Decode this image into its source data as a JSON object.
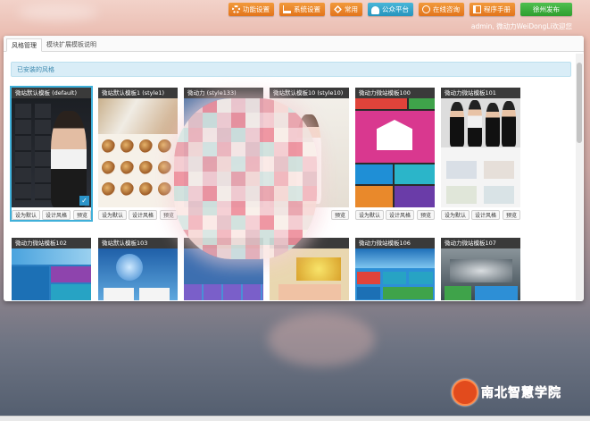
{
  "nav": {
    "buttons": [
      {
        "label": "功能设置",
        "icon": "gear-icon",
        "color": "#ee8a2e"
      },
      {
        "label": "系统设置",
        "icon": "cart-icon",
        "color": "#ee8a2e"
      },
      {
        "label": "常用",
        "icon": "tool-icon",
        "color": "#ee8a2e"
      },
      {
        "label": "公众平台",
        "icon": "cloud-icon",
        "color": "#3aa8d0"
      },
      {
        "label": "在线咨询",
        "icon": "chat-icon",
        "color": "#ee8a2e"
      },
      {
        "label": "程序手册",
        "icon": "book-icon",
        "color": "#ee8a2e"
      },
      {
        "label": "徐州发布",
        "color": "#3db33d"
      }
    ],
    "welcome": "admin, 微动力WeiDongLi欢迎您"
  },
  "tabs": [
    "风格管理",
    "模块扩展模板说明"
  ],
  "info": "已安装的风格",
  "card_buttons": {
    "set_default": "设为默认",
    "design": "设计风格",
    "preview": "预览"
  },
  "templates": [
    {
      "title": "微站默认模板 (default)",
      "selected": true
    },
    {
      "title": "微站默认模板1 (style1)"
    },
    {
      "title": "微动力 (style133)"
    },
    {
      "title": "微站默认模板10 (style10)"
    },
    {
      "title": "微动力微站模板100"
    },
    {
      "title": "微动力微站模板101"
    },
    {
      "title": "微动力微站模板102"
    },
    {
      "title": "微站默认模板103"
    },
    {
      "title": ""
    },
    {
      "title": ""
    },
    {
      "title": "微动力微站模板106"
    },
    {
      "title": "微动力微站模板107"
    }
  ],
  "watermark": "南北智慧学院",
  "colors": {
    "accent": "#3fb0d9",
    "info_bg": "#d9edf7",
    "info_text": "#3a87ad"
  }
}
